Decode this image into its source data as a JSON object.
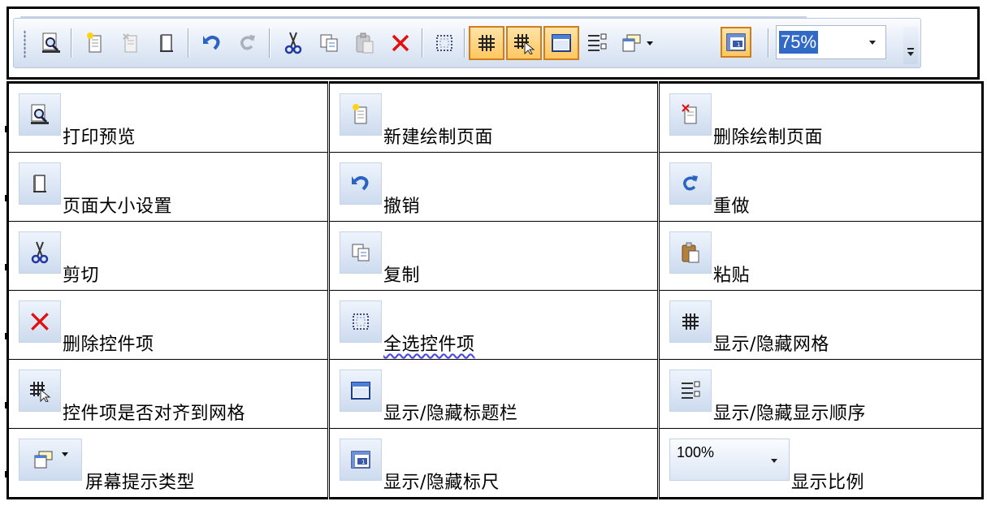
{
  "toolbar": {
    "zoom_value": "75%"
  },
  "items": [
    {
      "icon": "print-preview-icon",
      "label": "打印预览"
    },
    {
      "icon": "new-page-icon",
      "label": "新建绘制页面"
    },
    {
      "icon": "delete-page-icon",
      "label": "删除绘制页面"
    },
    {
      "icon": "page-size-icon",
      "label": "页面大小设置"
    },
    {
      "icon": "undo-icon",
      "label": "撤销"
    },
    {
      "icon": "redo-icon",
      "label": "重做"
    },
    {
      "icon": "cut-icon",
      "label": "剪切"
    },
    {
      "icon": "copy-icon",
      "label": "复制"
    },
    {
      "icon": "paste-icon",
      "label": "粘贴"
    },
    {
      "icon": "delete-control-icon",
      "label": "删除控件项"
    },
    {
      "icon": "select-all-icon",
      "label": "全选控件项"
    },
    {
      "icon": "grid-icon",
      "label": "显示/隐藏网格"
    },
    {
      "icon": "snap-to-grid-icon",
      "label": "控件项是否对齐到网格"
    },
    {
      "icon": "titlebar-icon",
      "label": "显示/隐藏标题栏"
    },
    {
      "icon": "display-order-icon",
      "label": "显示/隐藏显示顺序"
    },
    {
      "icon": "tooltip-type-icon",
      "label": "屏幕提示类型"
    },
    {
      "icon": "ruler-icon",
      "label": "显示/隐藏标尺"
    },
    {
      "icon": "zoom-combo",
      "label": "显示比例",
      "combo_value": "100%"
    }
  ],
  "colors": {
    "toolbar_active_fill": "#ffc861",
    "toolbar_active_border": "#d27d1c",
    "zoom_highlight": "#3169c6",
    "delete_red": "#e01010"
  }
}
